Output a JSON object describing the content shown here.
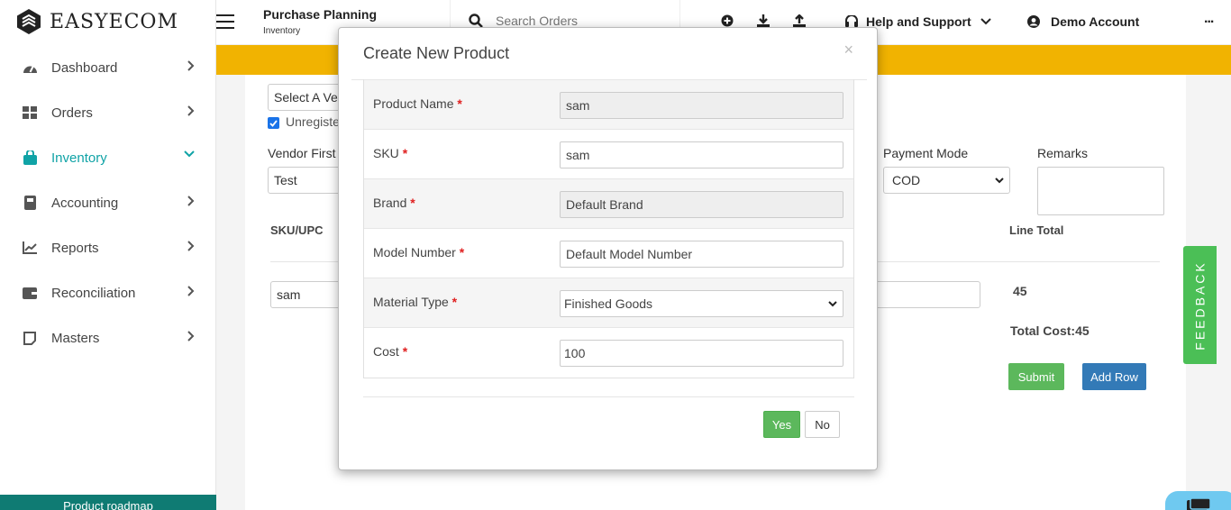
{
  "app": {
    "logo_text": "EASYECOM"
  },
  "sidebar": {
    "items": [
      {
        "label": "Dashboard",
        "icon": "dashboard-icon"
      },
      {
        "label": "Orders",
        "icon": "grid-icon"
      },
      {
        "label": "Inventory",
        "icon": "bag-icon",
        "active": true
      },
      {
        "label": "Accounting",
        "icon": "ledger-icon"
      },
      {
        "label": "Reports",
        "icon": "chart-icon"
      },
      {
        "label": "Reconciliation",
        "icon": "wallet-icon"
      },
      {
        "label": "Masters",
        "icon": "note-icon"
      }
    ],
    "footer": "Product roadmap"
  },
  "header": {
    "page_title": "Purchase Planning",
    "page_subtitle": "Inventory",
    "search_placeholder": "Search Orders",
    "help_label": "Help and Support",
    "account_label": "Demo Account",
    "more_label": "..."
  },
  "form": {
    "vendor_select": "Select A Ven",
    "unregistered_label": "Unregiste",
    "vendor_first_label": "Vendor First",
    "vendor_first_value": "Test",
    "payment_mode_label": "Payment Mode",
    "payment_mode_value": "COD",
    "remarks_label": "Remarks",
    "sku_header": "SKU/UPC",
    "line_total_header": "Line Total",
    "sku_value": "sam",
    "line_total_value": "45",
    "total_cost": "Total Cost:45",
    "submit_label": "Submit",
    "add_row_label": "Add Row"
  },
  "feedback_label": "FEEDBACK",
  "modal": {
    "title": "Create New Product",
    "close_label": "×",
    "fields": [
      {
        "label": "Product Name",
        "value": "sam",
        "readonly": true
      },
      {
        "label": "SKU",
        "value": "sam",
        "readonly": false
      },
      {
        "label": "Brand",
        "value": "Default Brand",
        "readonly": true
      },
      {
        "label": "Model Number",
        "value": "Default Model Number",
        "readonly": false
      },
      {
        "label": "Material Type",
        "value": "Finished Goods",
        "select": true
      },
      {
        "label": "Cost",
        "value": "100",
        "readonly": false
      }
    ],
    "required_mark": "*",
    "yes_label": "Yes",
    "no_label": "No"
  },
  "colors": {
    "banner": "#f1b301",
    "accent": "#10a3a6",
    "submit": "#5cb85c",
    "add_row": "#337ab7",
    "feedback": "#4bbf56"
  }
}
